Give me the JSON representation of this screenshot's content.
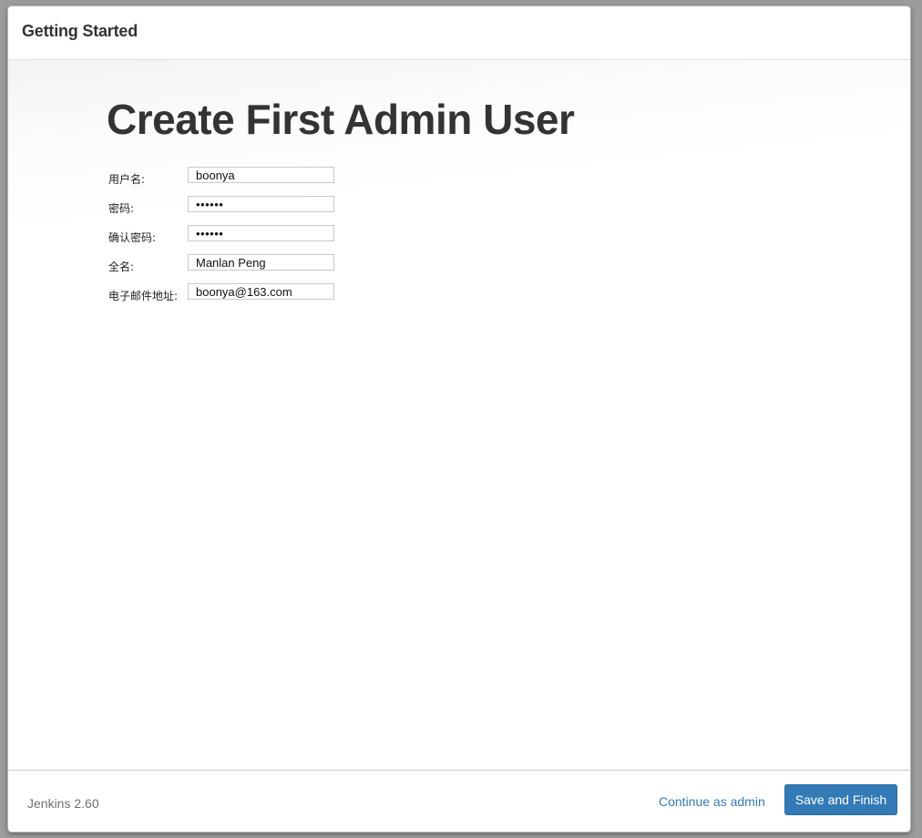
{
  "header": {
    "title": "Getting Started"
  },
  "main": {
    "heading": "Create First Admin User",
    "fields": [
      {
        "label": "用户名:",
        "value": "boonya",
        "type": "text"
      },
      {
        "label": "密码:",
        "value": "••••••",
        "type": "password"
      },
      {
        "label": "确认密码:",
        "value": "••••••",
        "type": "password"
      },
      {
        "label": "全名:",
        "value": "Manlan Peng",
        "type": "text"
      },
      {
        "label": "电子邮件地址:",
        "value": "boonya@163.com",
        "type": "text"
      }
    ]
  },
  "footer": {
    "version": "Jenkins 2.60",
    "continue_label": "Continue as admin",
    "save_label": "Save and Finish"
  },
  "colors": {
    "accent": "#337ab7",
    "text": "#333333",
    "muted": "#707070"
  }
}
